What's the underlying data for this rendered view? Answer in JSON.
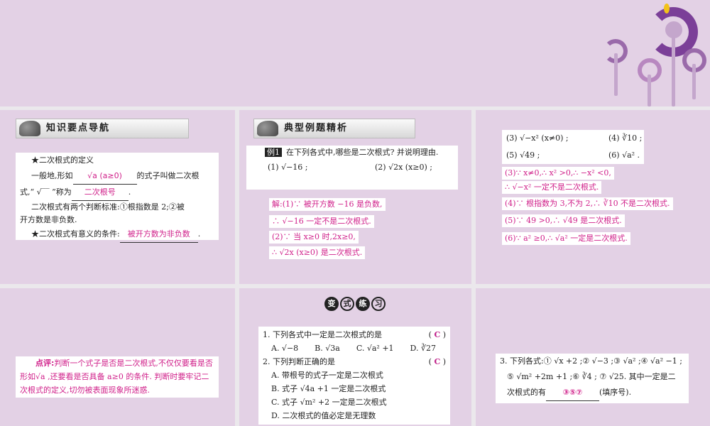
{
  "knowledge": {
    "header": "知识要点导航",
    "lines": [
      "★二次根式的定义",
      "一般地,形如",
      "的式子叫做二次根",
      "式,“ √‾‾ ”称为",
      ".",
      "二次根式有两个判断标准:①根指数是 2;②被",
      "开方数是非负数.",
      "★二次根式有意义的条件:",
      "."
    ],
    "blank1": "√a (a≥0)",
    "blank2": "二次根号",
    "blank3": "被开方数为非负数"
  },
  "example": {
    "header": "典型例题精析",
    "tag": "例1",
    "question": "在下列各式中,哪些是二次根式? 并说明理由.",
    "items": [
      "(1) √−16 ;",
      "(2) √2x (x≥0) ;"
    ],
    "solution": [
      "解:(1)∵ 被开方数 −16 是负数,",
      "∴ √−16 一定不是二次根式.",
      "(2)∵ 当 x≥0 时,2x≥0,",
      "∴ √2x (x≥0) 是二次根式."
    ]
  },
  "example_cont": {
    "items": [
      "(3) √−x² (x≠0) ;",
      "(4) ∛10 ;",
      "(5) √49 ;",
      "(6) √a² ."
    ],
    "solution": [
      "(3)∵ x≠0,∴ x² >0,∴ −x² <0,",
      "∴ √−x² 一定不是二次根式.",
      "(4)∵ 根指数为 3,不为 2,∴ ∛10 不是二次根式.",
      "(5)∵ 49 >0,∴ √49 是二次根式.",
      "(6)∵ a² ≥0,∴ √a² 一定是二次根式."
    ]
  },
  "comment": {
    "label": "点评:",
    "text": "判断一个式子是否是二次根式,不仅仅要看是否形如√a ,还要看是否具备 a≥0 的条件. 判断时要牢记二次根式的定义,切勿被表面现象所迷惑."
  },
  "practice": {
    "badge": [
      "变",
      "式",
      "练",
      "习"
    ],
    "q1": "1. 下列各式中一定是二次根式的是",
    "q1_answer": "C",
    "q1_options": [
      "A. √−8",
      "B. √3a",
      "C. √a² +1",
      "D. ∛27"
    ],
    "q2": "2. 下列判断正确的是",
    "q2_answer": "C",
    "q2_options": [
      "A. 带根号的式子一定是二次根式",
      "B. 式子 √4a +1 一定是二次根式",
      "C. 式子 √m² +2 一定是二次根式",
      "D. 二次根式的值必定是无理数"
    ]
  },
  "practice3": {
    "text1": "3. 下列各式:① √x +2 ;② √−3 ;③ √a² ;④ √a² −1 ;",
    "text2": "⑤ √m² +2m +1 ;⑥ ∛4 ; ⑦ √25. 其中一定是二",
    "text3a": "次根式的有",
    "answer": "③⑤⑦",
    "text3b": "(填序号)."
  },
  "colors": {
    "background": "#e3d1e5",
    "accent": "#d0208a",
    "deco": "#7b3f98"
  }
}
